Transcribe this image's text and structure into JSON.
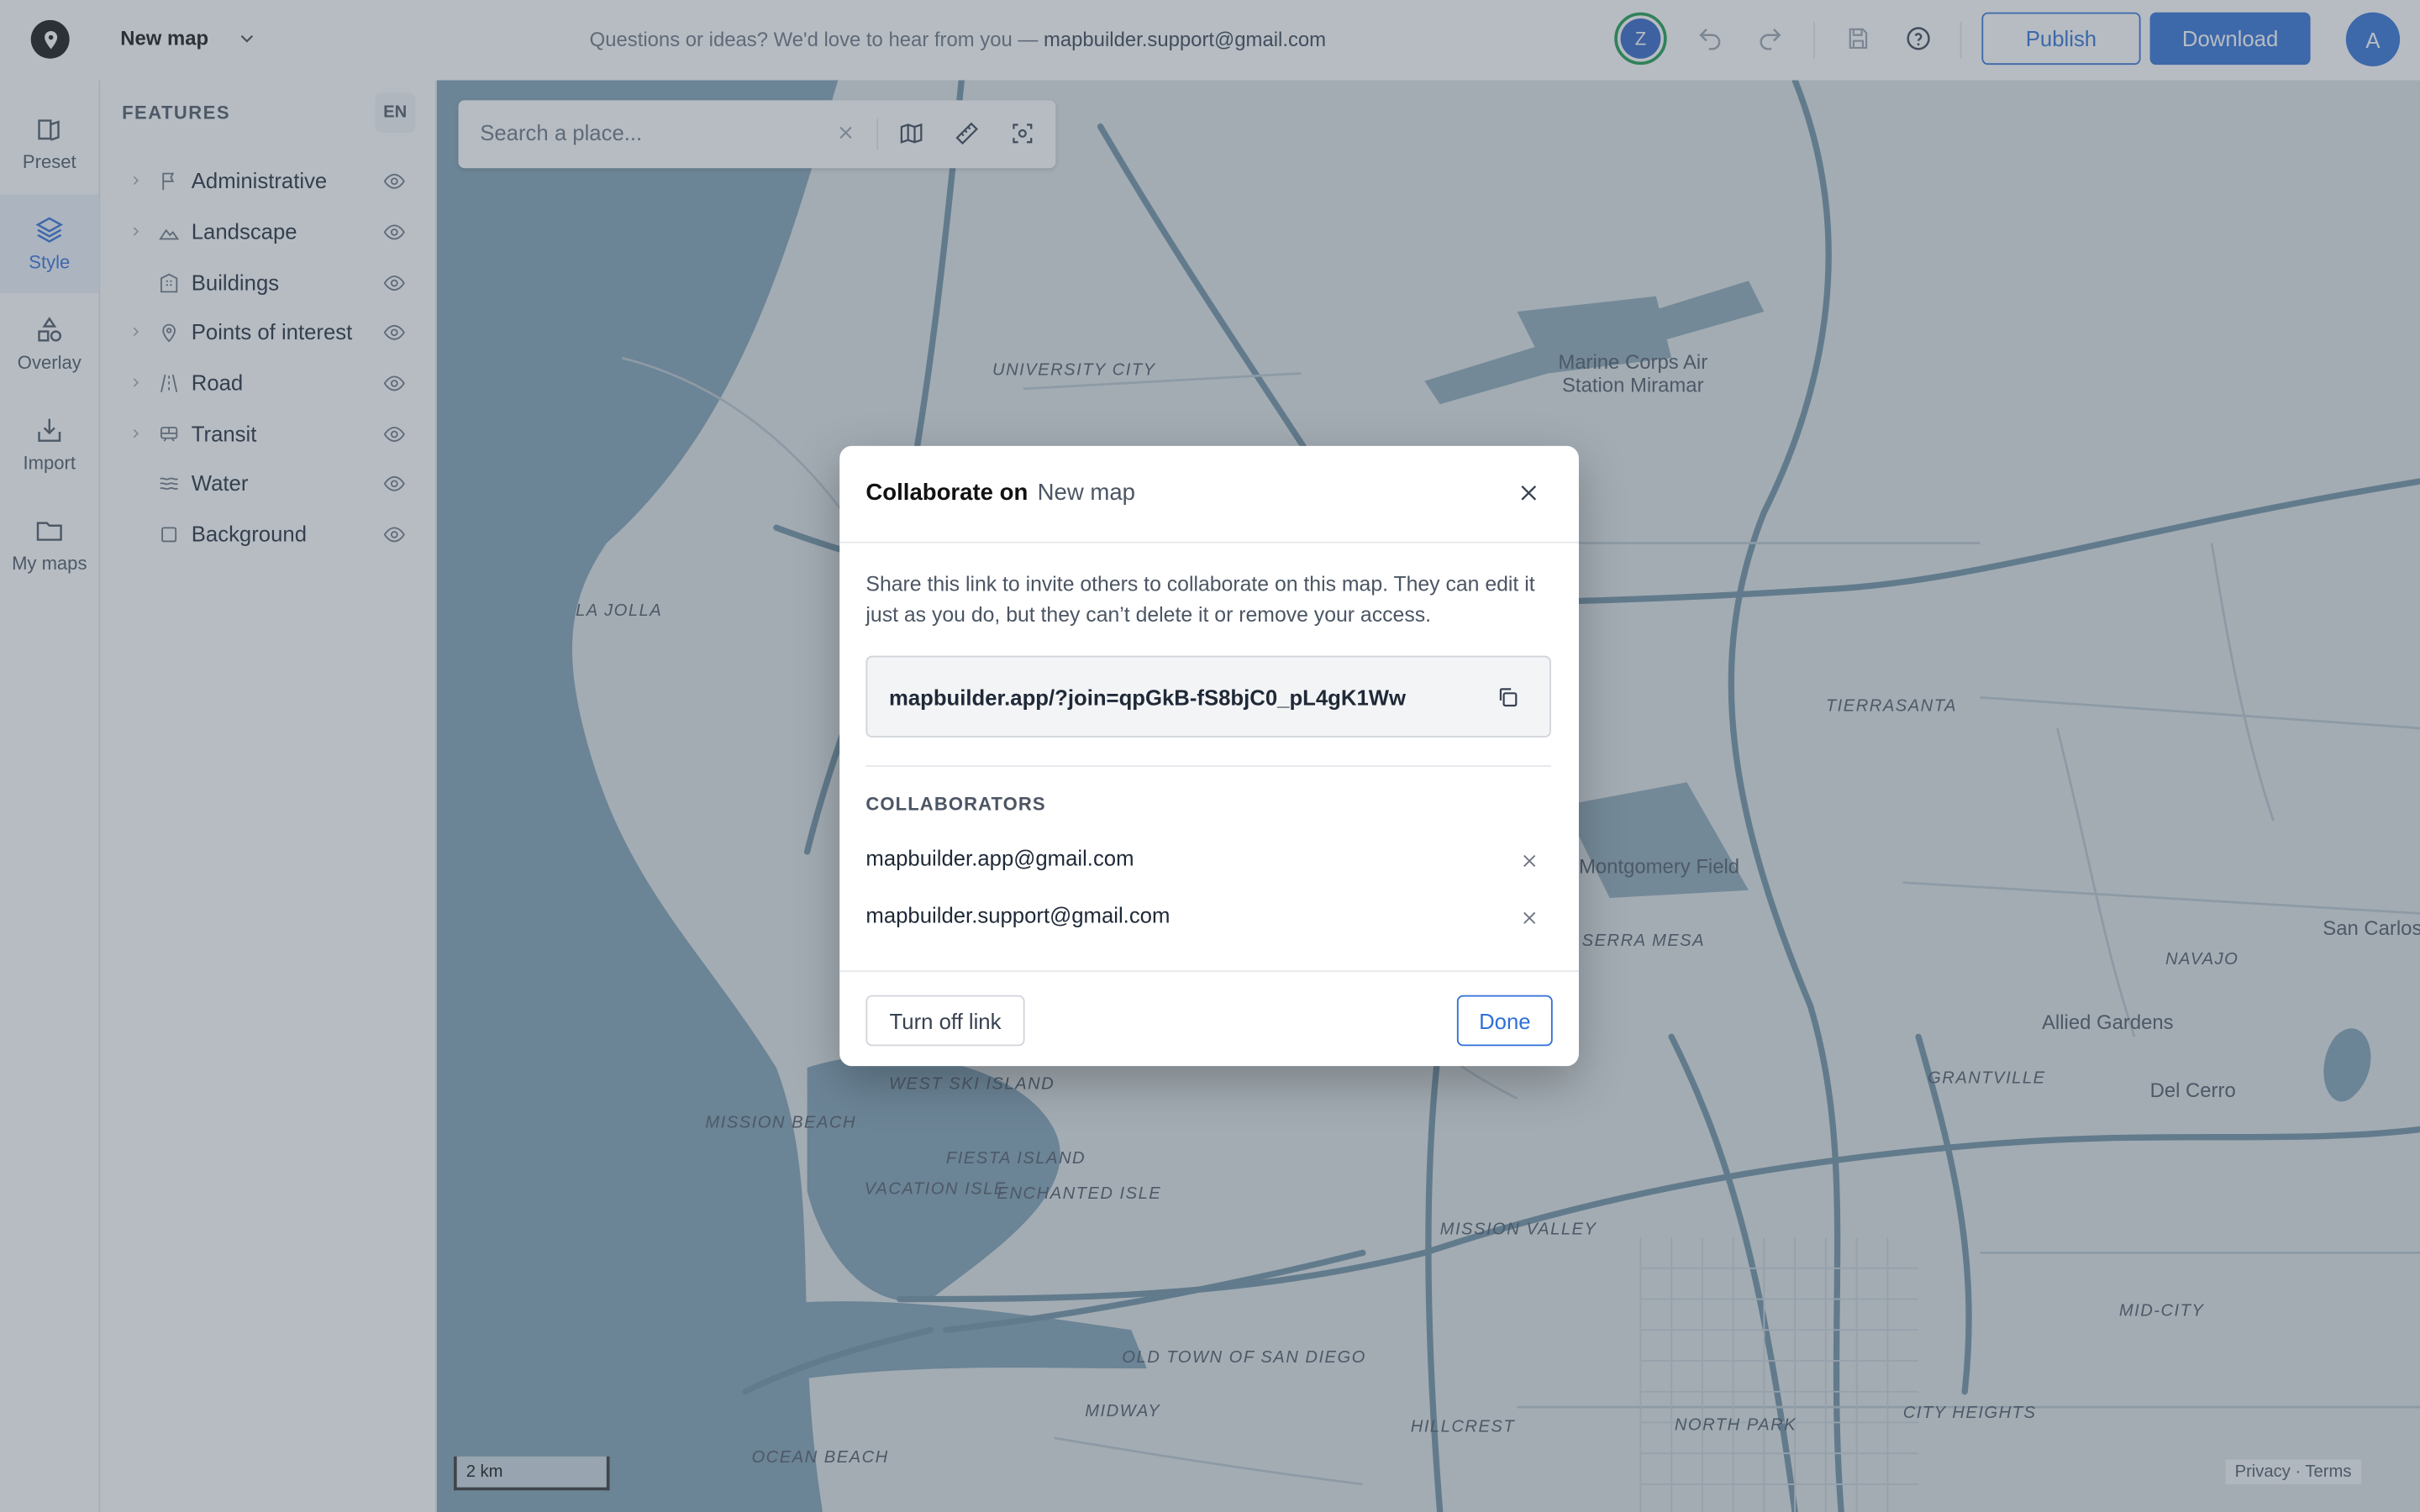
{
  "header": {
    "map_name": "New map",
    "feedback_text": "Questions or ideas? We'd love to hear from you — ",
    "feedback_email": "mapbuilder.support@gmail.com",
    "collaborator_initial": "Z",
    "publish_label": "Publish",
    "download_label": "Download",
    "user_initial": "A"
  },
  "rail": [
    {
      "label": "Preset",
      "icon": "preset-icon"
    },
    {
      "label": "Style",
      "icon": "layers-icon",
      "active": true
    },
    {
      "label": "Overlay",
      "icon": "shapes-icon"
    },
    {
      "label": "Import",
      "icon": "import-icon"
    },
    {
      "label": "My maps",
      "icon": "folder-icon"
    }
  ],
  "features_panel": {
    "title": "FEATURES",
    "lang": "EN",
    "items": [
      {
        "label": "Administrative",
        "expandable": true
      },
      {
        "label": "Landscape",
        "expandable": true
      },
      {
        "label": "Buildings",
        "expandable": false
      },
      {
        "label": "Points of interest",
        "expandable": true
      },
      {
        "label": "Road",
        "expandable": true
      },
      {
        "label": "Transit",
        "expandable": true
      },
      {
        "label": "Water",
        "expandable": false
      },
      {
        "label": "Background",
        "expandable": false
      }
    ]
  },
  "search": {
    "placeholder": "Search a place..."
  },
  "map": {
    "labels": [
      "UNIVERSITY CITY",
      "Marine Corps Air Station Miramar",
      "LA JOLLA",
      "TIERRASANTA",
      "Montgomery Field",
      "SERRA MESA",
      "San Carlos",
      "NAVAJO",
      "Allied Gardens",
      "GRANTVILLE",
      "Del Cerro",
      "MISSION BEACH",
      "WEST SKI ISLAND",
      "FIESTA ISLAND",
      "VACATION ISLE",
      "ENCHANTED ISLE",
      "MISSION VALLEY",
      "MID-CITY",
      "OLD TOWN OF SAN DIEGO",
      "MIDWAY",
      "OCEAN BEACH",
      "HILLCREST",
      "NORTH PARK",
      "CITY HEIGHTS"
    ],
    "scale": "2 km",
    "privacy": "Privacy",
    "terms": "Terms"
  },
  "modal": {
    "title": "Collaborate on",
    "map_name": "New map",
    "description": "Share this link to invite others to collaborate on this map. They can edit it just as you do, but they can’t delete it or remove your access.",
    "share_link": "mapbuilder.app/?join=qpGkB-fS8bjC0_pL4gK1Ww",
    "collaborators_heading": "COLLABORATORS",
    "collaborators": [
      "mapbuilder.app@gmail.com",
      "mapbuilder.support@gmail.com"
    ],
    "turn_off_label": "Turn off link",
    "done_label": "Done"
  }
}
